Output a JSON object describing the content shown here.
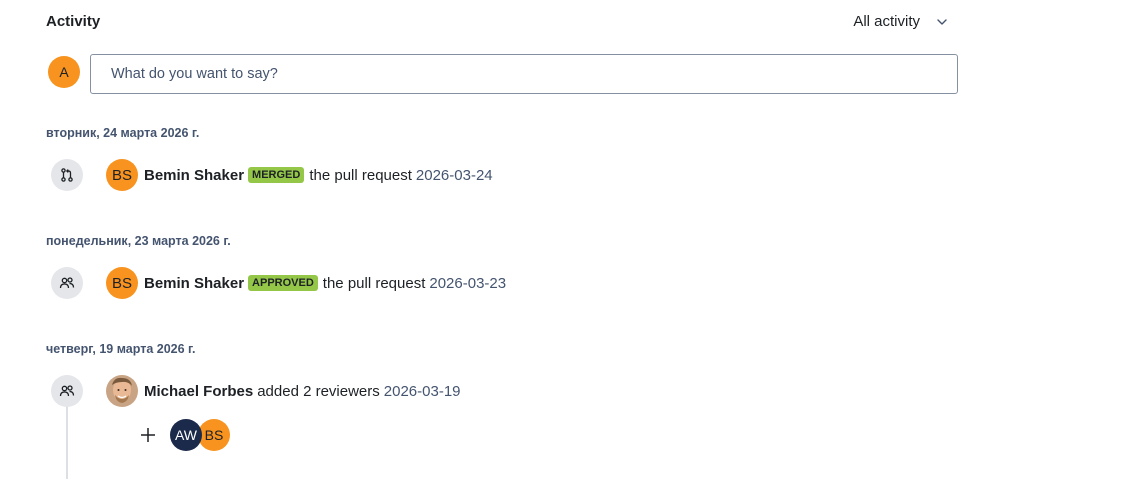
{
  "header": {
    "title": "Activity",
    "filter_label": "All activity"
  },
  "composer": {
    "avatar_initial": "A",
    "placeholder": "What do you want to say?"
  },
  "days": [
    {
      "label": "вторник, 24 марта 2026 г.",
      "event": {
        "icon": "pull-request-icon",
        "avatar_initials": "BS",
        "actor": "Bemin Shaker",
        "badge": "MERGED",
        "action": "the pull request",
        "timestamp": "2026-03-24"
      }
    },
    {
      "label": "понедельник, 23 марта 2026 г.",
      "event": {
        "icon": "people-icon",
        "avatar_initials": "BS",
        "actor": "Bemin Shaker",
        "badge": "APPROVED",
        "action": "the pull request",
        "timestamp": "2026-03-23"
      }
    },
    {
      "label": "четверг, 19 марта 2026 г.",
      "event": {
        "icon": "people-icon",
        "avatar_type": "photo",
        "actor": "Michael Forbes",
        "action": "added 2 reviewers",
        "timestamp": "2026-03-19",
        "reviewers": [
          {
            "initials": "AW",
            "color": "#1b2a4a"
          },
          {
            "initials": "BS",
            "color": "#f7931e"
          }
        ]
      }
    }
  ],
  "colors": {
    "avatar_orange": "#f7931e",
    "avatar_navy": "#1b2a4a",
    "lozenge_green": "#94c748",
    "icon_circle_bg": "#e4e6ea"
  }
}
